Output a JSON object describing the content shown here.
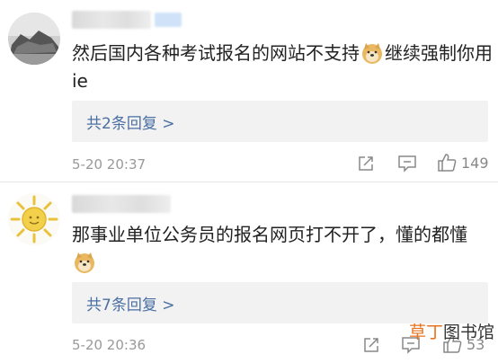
{
  "comments": [
    {
      "text_before": "然后国内各种考试报名的网站不支持",
      "text_after": "继续强制你用ie",
      "emoji": "doge-emoji",
      "replies_label": "共2条回复 >",
      "timestamp": "5-20 20:37",
      "likes": "149"
    },
    {
      "text_before": "那事业单位公务员的报名网页打不开了，懂的都懂",
      "text_after": "",
      "emoji": "doge-emoji",
      "replies_label": "共7条回复 >",
      "timestamp": "5-20 20:36",
      "likes": "53"
    }
  ],
  "watermark": {
    "part1": "草丁",
    "part2": "图书馆"
  },
  "colors": {
    "link": "#4a6fa3",
    "reply_bg": "#f2f2f2",
    "meta": "#999999",
    "watermark_accent": "#e8731e"
  }
}
